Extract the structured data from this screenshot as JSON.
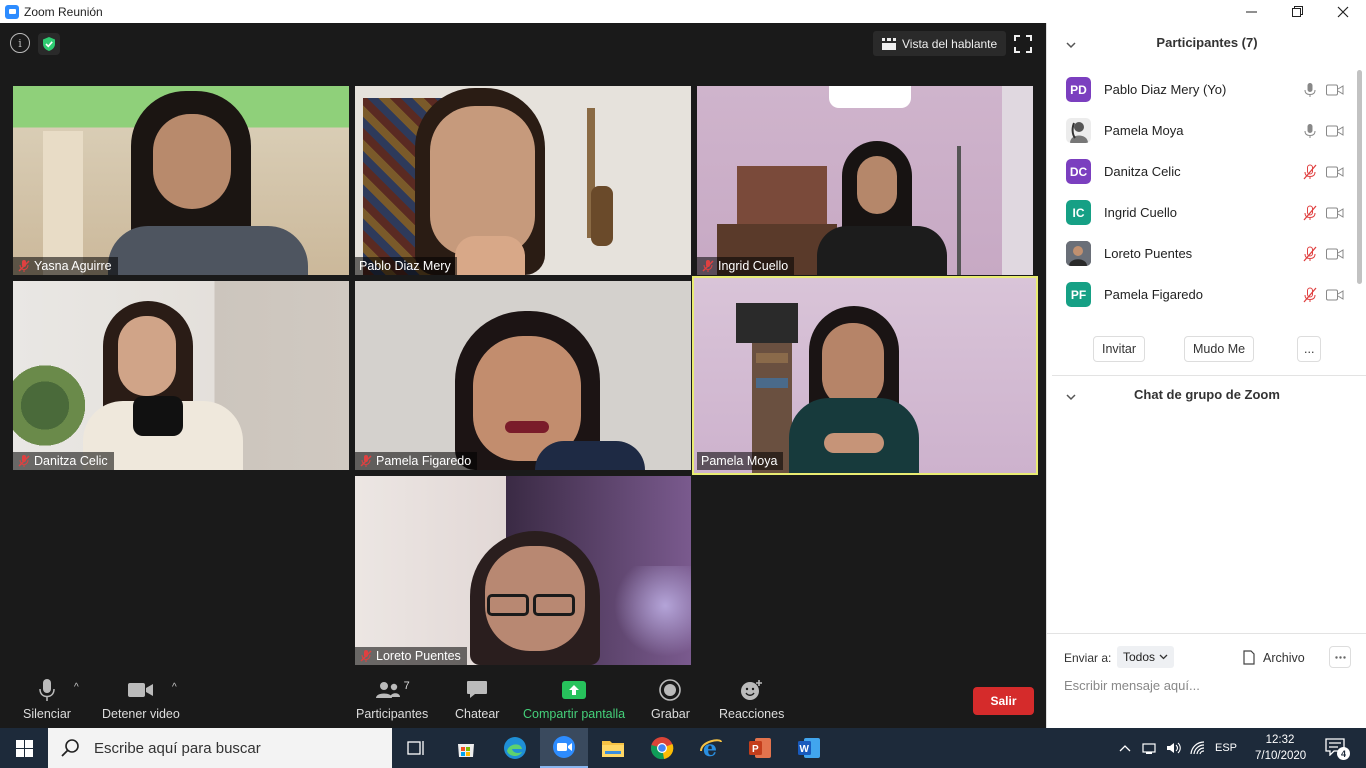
{
  "window": {
    "title": "Zoom Reunión",
    "controls": [
      "minimize",
      "restore",
      "close"
    ]
  },
  "meeting": {
    "view_button_label": "Vista del hablante",
    "tiles": [
      {
        "name": "Yasna Aguirre",
        "muted": true
      },
      {
        "name": "Pablo Diaz Mery",
        "muted": false
      },
      {
        "name": "Ingrid Cuello",
        "muted": true
      },
      {
        "name": "Danitza Celic",
        "muted": true
      },
      {
        "name": "Pamela Figaredo",
        "muted": true
      },
      {
        "name": "Pamela Moya",
        "muted": false,
        "active_speaker": true
      },
      {
        "name": "Loreto Puentes",
        "muted": true
      }
    ]
  },
  "toolbar": {
    "mute_label": "Silenciar",
    "video_label": "Detener video",
    "participants_label": "Participantes",
    "participants_count": "7",
    "chat_label": "Chatear",
    "share_label": "Compartir pantalla",
    "record_label": "Grabar",
    "reactions_label": "Reacciones",
    "leave_label": "Salir"
  },
  "panel": {
    "participants_title": "Participantes (7)",
    "participants": [
      {
        "initials": "PD",
        "name": "Pablo Diaz Mery (Yo)",
        "color": "#7b3fbf",
        "mic_muted": false
      },
      {
        "initials": "",
        "name": "Pamela Moya",
        "color": "#cccccc",
        "mic_muted": false,
        "photo": true
      },
      {
        "initials": "DC",
        "name": "Danitza Celic",
        "color": "#7b3fbf",
        "mic_muted": true
      },
      {
        "initials": "IC",
        "name": "Ingrid Cuello",
        "color": "#16a085",
        "mic_muted": true
      },
      {
        "initials": "",
        "name": "Loreto Puentes",
        "color": "#555555",
        "mic_muted": true,
        "photo": true
      },
      {
        "initials": "PF",
        "name": "Pamela Figaredo",
        "color": "#16a085",
        "mic_muted": true
      }
    ],
    "invite_label": "Invitar",
    "mute_me_label": "Mudo Me",
    "more_label": "...",
    "chat_title": "Chat de grupo de Zoom",
    "send_to_label": "Enviar a:",
    "send_to_value": "Todos",
    "file_label": "Archivo",
    "chat_placeholder": "Escribir mensaje aquí..."
  },
  "taskbar": {
    "search_placeholder": "Escribe aquí para buscar",
    "language": "ESP",
    "time": "12:32",
    "date": "7/10/2020",
    "notifications": "4"
  },
  "colors": {
    "meeting_bg": "#1a1a1a",
    "active_border": "#e9ec72",
    "leave_red": "#d52b2b",
    "share_green": "#45d07a",
    "mute_red": "#e04040"
  }
}
